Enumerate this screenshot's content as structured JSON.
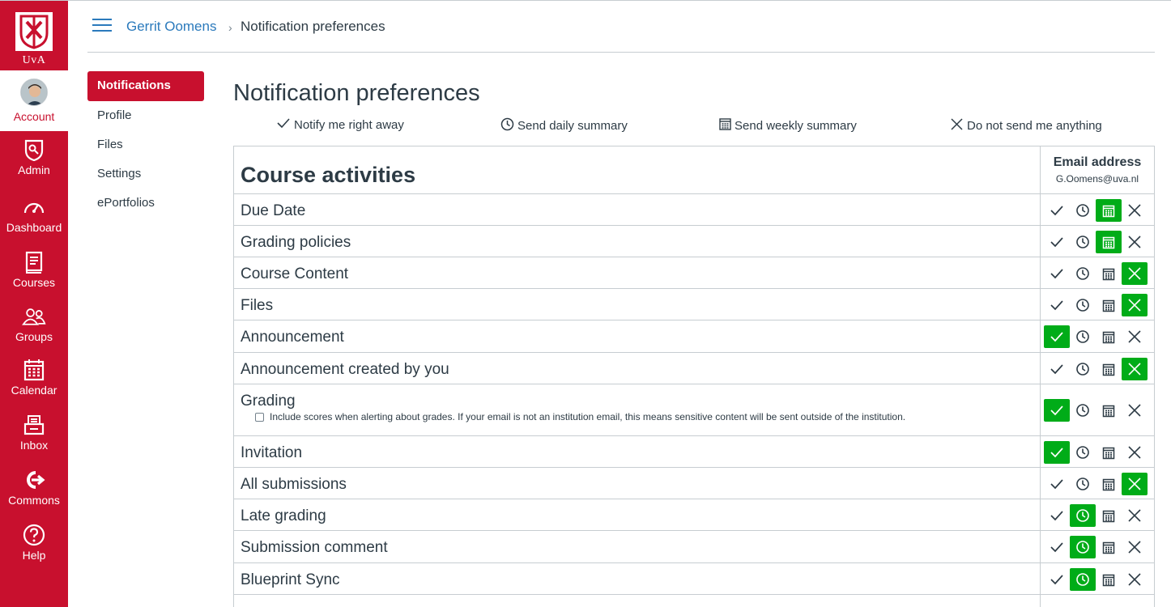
{
  "logo": {
    "text": "UvA"
  },
  "global_nav": {
    "account": "Account",
    "items": [
      {
        "label": "Admin",
        "icon": "admin-shield-icon"
      },
      {
        "label": "Dashboard",
        "icon": "dashboard-gauge-icon"
      },
      {
        "label": "Courses",
        "icon": "courses-book-icon"
      },
      {
        "label": "Groups",
        "icon": "groups-people-icon"
      },
      {
        "label": "Calendar",
        "icon": "calendar-icon"
      },
      {
        "label": "Inbox",
        "icon": "inbox-icon"
      },
      {
        "label": "Commons",
        "icon": "commons-icon"
      },
      {
        "label": "Help",
        "icon": "help-icon"
      }
    ]
  },
  "breadcrumb": {
    "user": "Gerrit Oomens",
    "separator": "›",
    "current": "Notification preferences"
  },
  "section_menu": {
    "items": [
      "Notifications",
      "Profile",
      "Files",
      "Settings",
      "ePortfolios"
    ],
    "active": "Notifications"
  },
  "page": {
    "title": "Notification preferences"
  },
  "legend": {
    "right_away": "Notify me right away",
    "daily": "Send daily summary",
    "weekly": "Send weekly summary",
    "never": "Do not send me anything"
  },
  "table": {
    "category": "Course activities",
    "column_header": "Email address",
    "column_email": "G.Oomens@uva.nl",
    "rows": [
      {
        "name": "Due Date",
        "selected": "weekly"
      },
      {
        "name": "Grading policies",
        "selected": "weekly"
      },
      {
        "name": "Course Content",
        "selected": "never"
      },
      {
        "name": "Files",
        "selected": "never"
      },
      {
        "name": "Announcement",
        "selected": "right_away"
      },
      {
        "name": "Announcement created by you",
        "selected": "never"
      },
      {
        "name": "Grading",
        "selected": "right_away",
        "option": "Include scores when alerting about grades. If your email is not an institution email, this means sensitive content will be sent outside of the institution."
      },
      {
        "name": "Invitation",
        "selected": "right_away"
      },
      {
        "name": "All submissions",
        "selected": "never"
      },
      {
        "name": "Late grading",
        "selected": "daily"
      },
      {
        "name": "Submission comment",
        "selected": "daily"
      },
      {
        "name": "Blueprint Sync",
        "selected": "daily"
      }
    ]
  },
  "colors": {
    "brand": "#c8102e",
    "selected": "#00ac18",
    "link": "#2b7abc",
    "text": "#2d3b45",
    "border": "#c7cdd1"
  }
}
